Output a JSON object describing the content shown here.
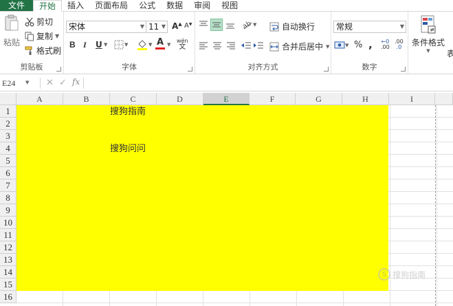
{
  "tabs": [
    "文件",
    "开始",
    "插入",
    "页面布局",
    "公式",
    "数据",
    "审阅",
    "视图"
  ],
  "clipboard": {
    "paste": "粘贴",
    "cut": "剪切",
    "copy": "复制",
    "format_painter": "格式刷",
    "label": "剪贴板"
  },
  "font": {
    "name": "宋体",
    "size": "11",
    "bold": "B",
    "italic": "I",
    "underline": "U",
    "grow": "A",
    "shrink": "A",
    "font_color": "A",
    "phonetic": "wén",
    "label": "字体"
  },
  "alignment": {
    "wrap_text": "自动换行",
    "merge_center": "合并后居中",
    "label": "对齐方式"
  },
  "number": {
    "format": "常规",
    "percent": "%",
    "comma": ",",
    "inc_decimal": ".00",
    "dec_decimal": ".0",
    "label": "数字"
  },
  "styles": {
    "conditional": "条件格式",
    "table": "表"
  },
  "formula_bar": {
    "name_box": "E24",
    "fx": "fx",
    "value": ""
  },
  "sheet": {
    "columns": [
      "A",
      "B",
      "C",
      "D",
      "E",
      "F",
      "G",
      "H",
      "I"
    ],
    "selected_column": "E",
    "rows": [
      "1",
      "2",
      "3",
      "4",
      "5",
      "6",
      "7",
      "8",
      "9",
      "10",
      "11",
      "12",
      "13",
      "14",
      "15",
      "16"
    ],
    "fill_color": "#ffff00",
    "cells": {
      "C1": "搜狗指南",
      "C4": "搜狗问问"
    }
  },
  "watermark": "搜狗指南",
  "colors": {
    "accent": "#217346"
  }
}
